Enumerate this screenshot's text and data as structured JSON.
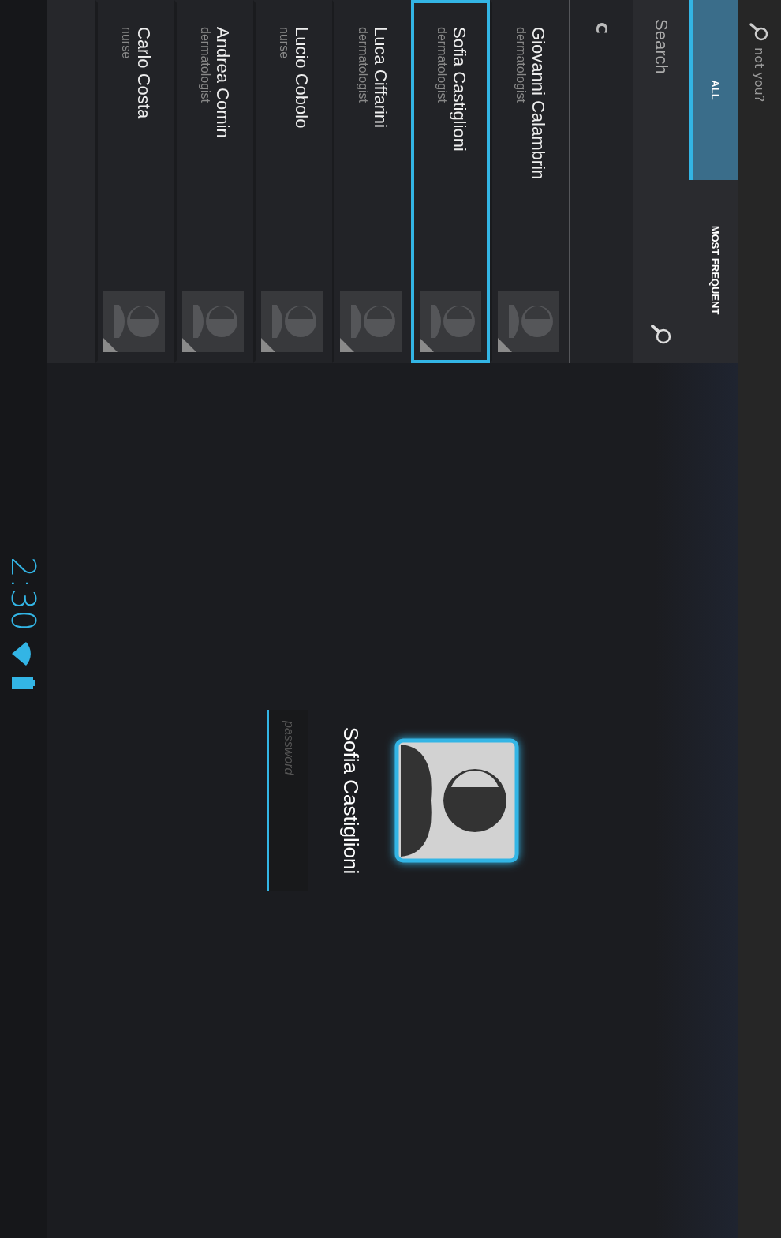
{
  "header": {
    "link": "not you?"
  },
  "tabs": [
    {
      "label": "ALL",
      "selected": true
    },
    {
      "label": "MOST FREQUENT",
      "selected": false
    }
  ],
  "search": {
    "placeholder": "Search"
  },
  "section": "C",
  "users": [
    {
      "name": "Giovanni Calambrin",
      "role": "dermatologist",
      "selected": false
    },
    {
      "name": "Sofia Castiglioni",
      "role": "dermatologist",
      "selected": true
    },
    {
      "name": "Luca Ciffarini",
      "role": "dermatologist",
      "selected": false
    },
    {
      "name": "Lucio Cobolo",
      "role": "nurse",
      "selected": false
    },
    {
      "name": "Andrea Comin",
      "role": "dermatologist",
      "selected": false
    },
    {
      "name": "Carlo Costa",
      "role": "nurse",
      "selected": false
    }
  ],
  "login": {
    "name": "Sofia Castiglioni",
    "password_placeholder": "password"
  },
  "status_bar": {
    "time": "2:30"
  }
}
